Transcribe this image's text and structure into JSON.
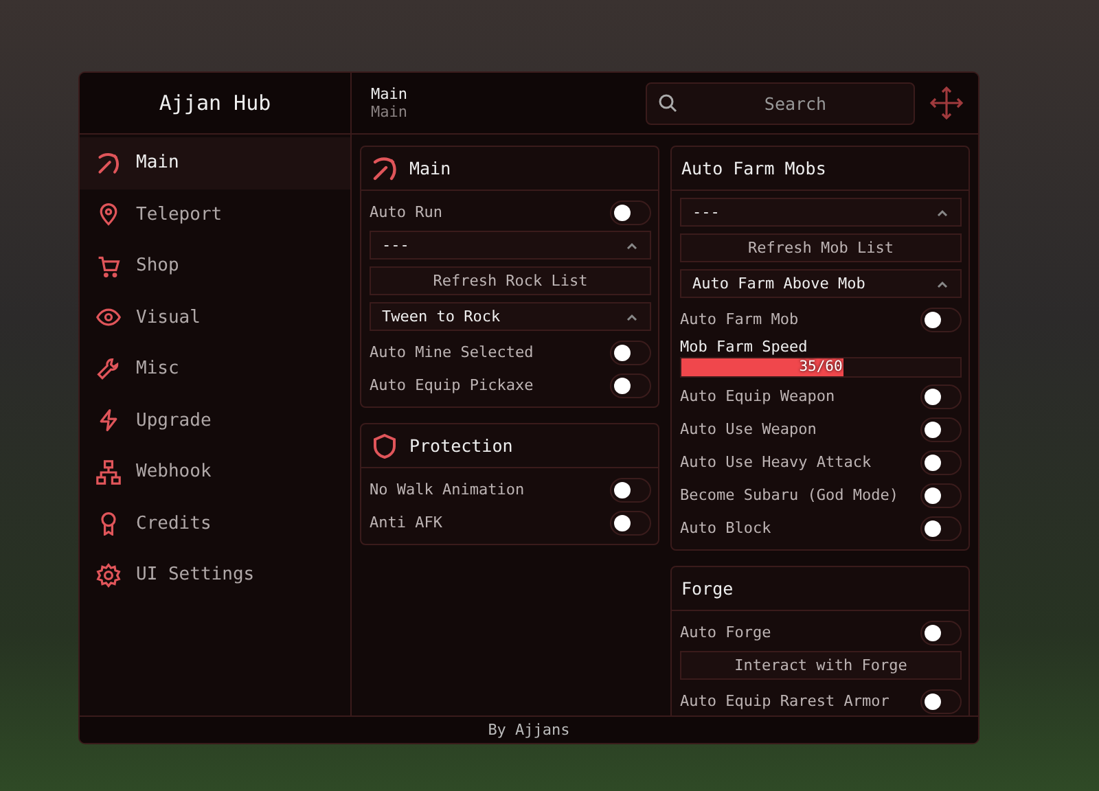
{
  "window": {
    "title": "Ajjan Hub"
  },
  "breadcrumb": {
    "title": "Main",
    "subtitle": "Main"
  },
  "search": {
    "placeholder": "Search"
  },
  "sidebar": {
    "items": [
      {
        "label": "Main",
        "selected": true
      },
      {
        "label": "Teleport",
        "selected": false
      },
      {
        "label": "Shop",
        "selected": false
      },
      {
        "label": "Visual",
        "selected": false
      },
      {
        "label": "Misc",
        "selected": false
      },
      {
        "label": "Upgrade",
        "selected": false
      },
      {
        "label": "Webhook",
        "selected": false
      },
      {
        "label": "Credits",
        "selected": false
      },
      {
        "label": "UI Settings",
        "selected": false
      }
    ]
  },
  "columns": [
    {
      "sections": [
        {
          "title": "Main",
          "items": [
            {
              "kind": "toggle",
              "label": "Auto Run",
              "on": false
            },
            {
              "kind": "dropdown",
              "value": "---"
            },
            {
              "kind": "button",
              "label": "Refresh Rock List"
            },
            {
              "kind": "dropdown",
              "value": "Tween to Rock"
            },
            {
              "kind": "toggle",
              "label": "Auto Mine Selected",
              "on": false
            },
            {
              "kind": "toggle",
              "label": "Auto Equip Pickaxe",
              "on": false
            }
          ]
        },
        {
          "title": "Protection",
          "items": [
            {
              "kind": "toggle",
              "label": "No Walk Animation",
              "on": false
            },
            {
              "kind": "toggle",
              "label": "Anti AFK",
              "on": false
            }
          ]
        }
      ]
    },
    {
      "sections": [
        {
          "title": "Auto Farm Mobs",
          "items": [
            {
              "kind": "dropdown",
              "value": "---"
            },
            {
              "kind": "button",
              "label": "Refresh Mob List"
            },
            {
              "kind": "dropdown",
              "value": "Auto Farm Above Mob"
            },
            {
              "kind": "toggle",
              "label": "Auto Farm Mob",
              "on": false
            },
            {
              "kind": "slider",
              "label": "Mob Farm Speed",
              "level": 0.583,
              "reading": "35/60"
            },
            {
              "kind": "toggle",
              "label": "Auto Equip Weapon",
              "on": false
            },
            {
              "kind": "toggle",
              "label": "Auto Use Weapon",
              "on": false
            },
            {
              "kind": "toggle",
              "label": "Auto Use Heavy Attack",
              "on": false
            },
            {
              "kind": "toggle",
              "label": "Become Subaru (God Mode)",
              "on": false
            },
            {
              "kind": "toggle",
              "label": "Auto Block",
              "on": false
            }
          ]
        },
        {
          "title": "Forge",
          "items": [
            {
              "kind": "toggle",
              "label": "Auto Forge",
              "on": false
            },
            {
              "kind": "button",
              "label": "Interact with Forge"
            },
            {
              "kind": "toggle",
              "label": "Auto Equip Rarest Armor",
              "on": false
            }
          ]
        }
      ]
    }
  ],
  "footer": {
    "text": "By Ajjans"
  }
}
